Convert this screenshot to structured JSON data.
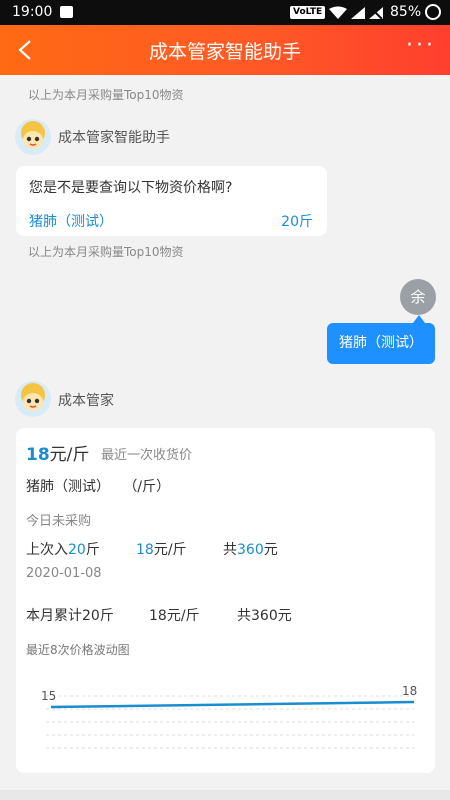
{
  "status": {
    "time": "19:00",
    "volte": "VoLTE",
    "battery": "85%"
  },
  "header": {
    "title": "成本管家智能助手",
    "more_icon": "more-dots-icon",
    "back_icon": "back-arrow-icon"
  },
  "hint_top": "以上为本月采购量Top10物资",
  "bot1": {
    "sender": "成本管家智能助手",
    "question": "您是不是要查询以下物资价格啊?",
    "item_name": "猪肺（测试）",
    "item_qty": "20斤",
    "hint": "以上为本月采购量Top10物资"
  },
  "user": {
    "avatar_text": "余",
    "message": "猪肺（测试）"
  },
  "bot2": {
    "sender": "成本管家",
    "price_value": "18",
    "price_unit": "元/斤",
    "price_note": "最近一次收货价",
    "item_line": "猪肺（测试）   （/斤）",
    "today": "今日未采购",
    "last_label": "上次入",
    "last_qty": "20",
    "last_qty_unit": "斤",
    "last_price": "18",
    "last_price_unit": "元/斤",
    "last_total_label": "共",
    "last_total": "360",
    "last_total_unit": "元",
    "last_date": "2020-01-08",
    "month_label": "本月累计20斤",
    "month_price": "18元/斤",
    "month_total": "共360元",
    "chart_title": "最近8次价格波动图"
  },
  "chart_data": {
    "type": "line",
    "series": [
      {
        "name": "",
        "values": [
          15,
          18
        ]
      }
    ],
    "labels": [
      "15",
      "18"
    ],
    "ylim": [
      0,
      20
    ],
    "grid": true,
    "line_color": "#1a8dd0"
  }
}
